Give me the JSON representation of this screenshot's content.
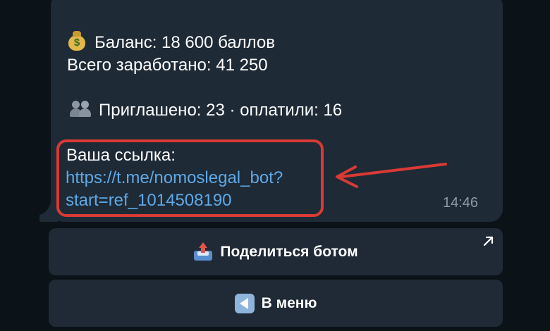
{
  "message": {
    "balance_line": "Баланс: 18 600 баллов",
    "earned_line": "Всего заработано: 41 250",
    "invited_line": "Приглашено: 23 · оплатили: 16",
    "link_label": "Ваша ссылка:",
    "link_part1": "https://t.me/nomoslegal_bot?",
    "link_part2": "start=ref_1014508190",
    "time": "14:46",
    "money_bag_icon_symbol": "$"
  },
  "keyboard": {
    "share_label": "Поделиться ботом",
    "menu_label": "В меню"
  },
  "colors": {
    "background": "#0b1218",
    "bubble": "#1e2a36",
    "link": "#5fa9e6",
    "highlight": "#d93a35",
    "time": "#8e9aa6"
  },
  "icons": [
    "money-bag-icon",
    "busts-icon",
    "outbox-tray-icon",
    "back-arrow-icon",
    "external-arrow-icon",
    "annotation-arrow"
  ]
}
